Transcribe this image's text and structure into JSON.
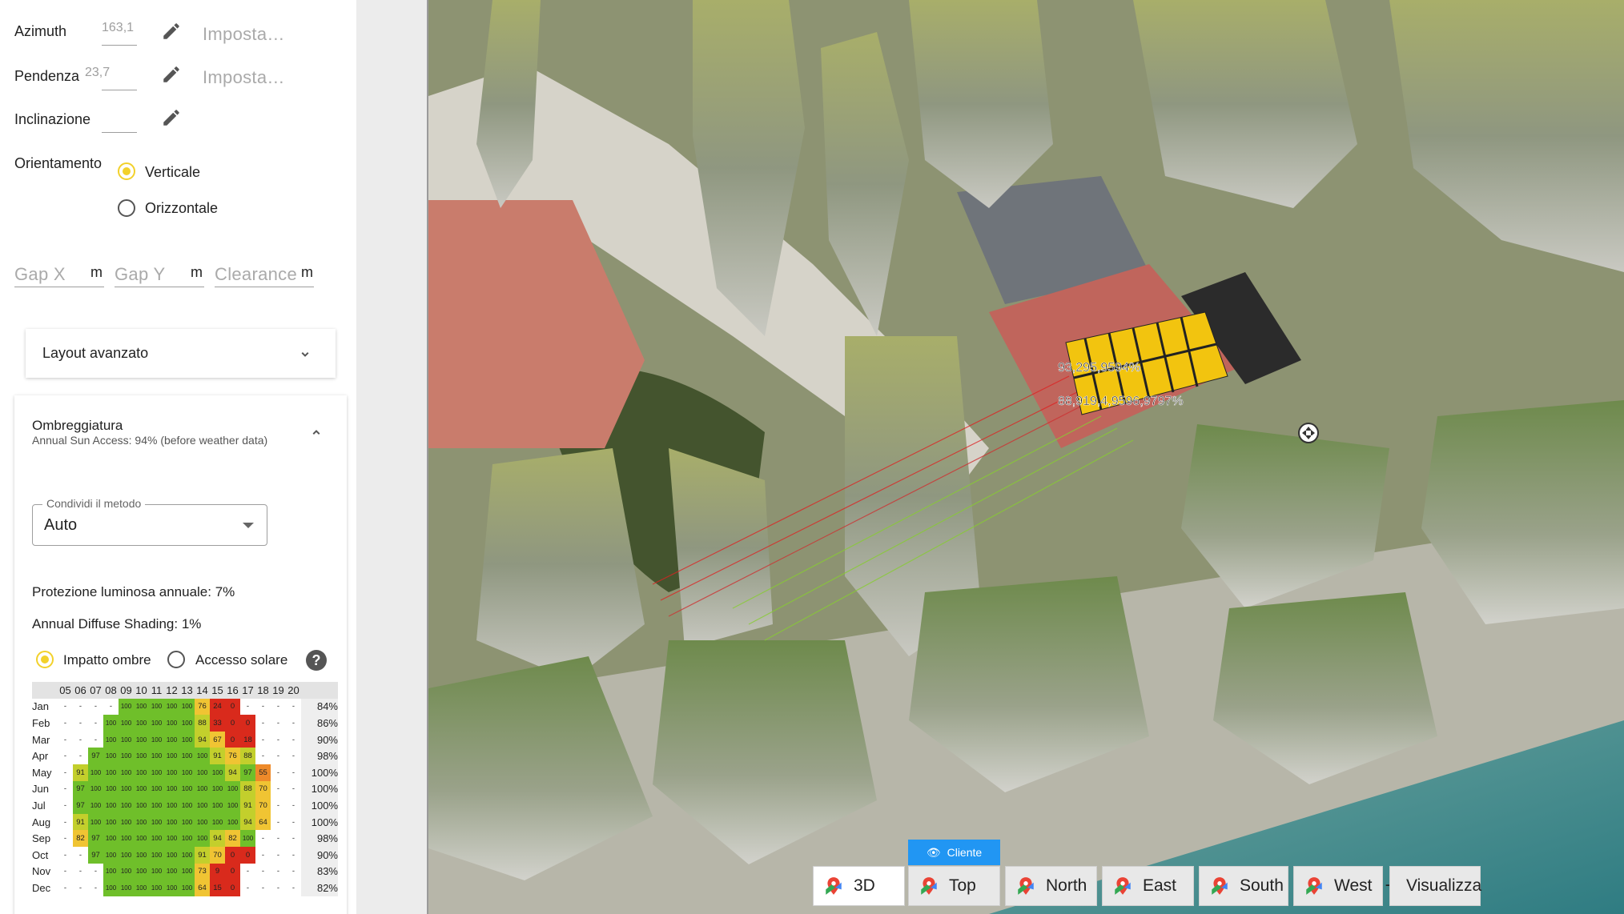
{
  "fields": {
    "azimuth_label": "Azimuth",
    "azimuth_value": "163,1",
    "azimuth_placeholder": "Imposta…",
    "pendenza_label": "Pendenza",
    "pendenza_value": "23,7",
    "pendenza_placeholder": "Imposta…",
    "inclinazione_label": "Inclinazione",
    "orientamento_label": "Orientamento",
    "orient_vertical": "Verticale",
    "orient_horizontal": "Orizzontale",
    "gap_x": "Gap X",
    "gap_y": "Gap Y",
    "clearance": "Clearance",
    "unit": "m"
  },
  "layout_avanzato": "Layout avanzato",
  "shading": {
    "title": "Ombreggiatura",
    "subtitle": "Annual Sun Access: 94% (before weather data)",
    "method_label": "Condividi il metodo",
    "method_value": "Auto",
    "annual_protection": "Protezione luminosa annuale: 7%",
    "annual_diffuse": "Annual Diffuse Shading: 1%",
    "radio_impact": "Impatto ombre",
    "radio_access": "Accesso solare",
    "hours": [
      "05",
      "06",
      "07",
      "08",
      "09",
      "10",
      "11",
      "12",
      "13",
      "14",
      "15",
      "16",
      "17",
      "18",
      "19",
      "20"
    ],
    "months": [
      {
        "m": "Jan",
        "v": [
          "-",
          "-",
          "-",
          "-",
          "100",
          "100",
          "100",
          "100",
          "100",
          "76",
          "24",
          "0",
          "-",
          "-",
          "-",
          "-"
        ],
        "p": "84%"
      },
      {
        "m": "Feb",
        "v": [
          "-",
          "-",
          "-",
          "100",
          "100",
          "100",
          "100",
          "100",
          "100",
          "88",
          "33",
          "0",
          "0",
          "-",
          "-",
          "-"
        ],
        "p": "86%"
      },
      {
        "m": "Mar",
        "v": [
          "-",
          "-",
          "-",
          "100",
          "100",
          "100",
          "100",
          "100",
          "100",
          "94",
          "67",
          "0",
          "18",
          "-",
          "-",
          "-"
        ],
        "p": "90%"
      },
      {
        "m": "Apr",
        "v": [
          "-",
          "-",
          "97",
          "100",
          "100",
          "100",
          "100",
          "100",
          "100",
          "100",
          "91",
          "76",
          "88",
          "-",
          "-",
          "-"
        ],
        "p": "98%"
      },
      {
        "m": "May",
        "v": [
          "-",
          "91",
          "100",
          "100",
          "100",
          "100",
          "100",
          "100",
          "100",
          "100",
          "100",
          "94",
          "97",
          "55",
          "-",
          "-"
        ],
        "p": "100%"
      },
      {
        "m": "Jun",
        "v": [
          "-",
          "97",
          "100",
          "100",
          "100",
          "100",
          "100",
          "100",
          "100",
          "100",
          "100",
          "100",
          "88",
          "70",
          "-",
          "-"
        ],
        "p": "100%"
      },
      {
        "m": "Jul",
        "v": [
          "-",
          "97",
          "100",
          "100",
          "100",
          "100",
          "100",
          "100",
          "100",
          "100",
          "100",
          "100",
          "91",
          "70",
          "-",
          "-"
        ],
        "p": "100%"
      },
      {
        "m": "Aug",
        "v": [
          "-",
          "91",
          "100",
          "100",
          "100",
          "100",
          "100",
          "100",
          "100",
          "100",
          "100",
          "100",
          "94",
          "64",
          "-",
          "-"
        ],
        "p": "100%"
      },
      {
        "m": "Sep",
        "v": [
          "-",
          "82",
          "97",
          "100",
          "100",
          "100",
          "100",
          "100",
          "100",
          "100",
          "94",
          "82",
          "100",
          "-",
          "-",
          "-"
        ],
        "p": "98%"
      },
      {
        "m": "Oct",
        "v": [
          "-",
          "-",
          "97",
          "100",
          "100",
          "100",
          "100",
          "100",
          "100",
          "91",
          "70",
          "0",
          "0",
          "-",
          "-",
          "-"
        ],
        "p": "90%"
      },
      {
        "m": "Nov",
        "v": [
          "-",
          "-",
          "-",
          "100",
          "100",
          "100",
          "100",
          "100",
          "100",
          "73",
          "9",
          "0",
          "-",
          "-",
          "-",
          "-"
        ],
        "p": "83%"
      },
      {
        "m": "Dec",
        "v": [
          "-",
          "-",
          "-",
          "100",
          "100",
          "100",
          "100",
          "100",
          "100",
          "64",
          "15",
          "0",
          "-",
          "-",
          "-",
          "-"
        ],
        "p": "82%"
      }
    ]
  },
  "map": {
    "row1": "93,295,9594%",
    "row2": "88,919,4,9596,9797%",
    "cliente": "Cliente",
    "views": [
      "3D",
      "Top",
      "North",
      "East",
      "South",
      "West"
    ],
    "visualizza": "Visualizza",
    "plus": "+"
  },
  "colors": {
    "accent_yellow": "#f2d12b",
    "blue": "#2196f3",
    "green": "#6fbf2a",
    "red": "#d92a1c"
  }
}
